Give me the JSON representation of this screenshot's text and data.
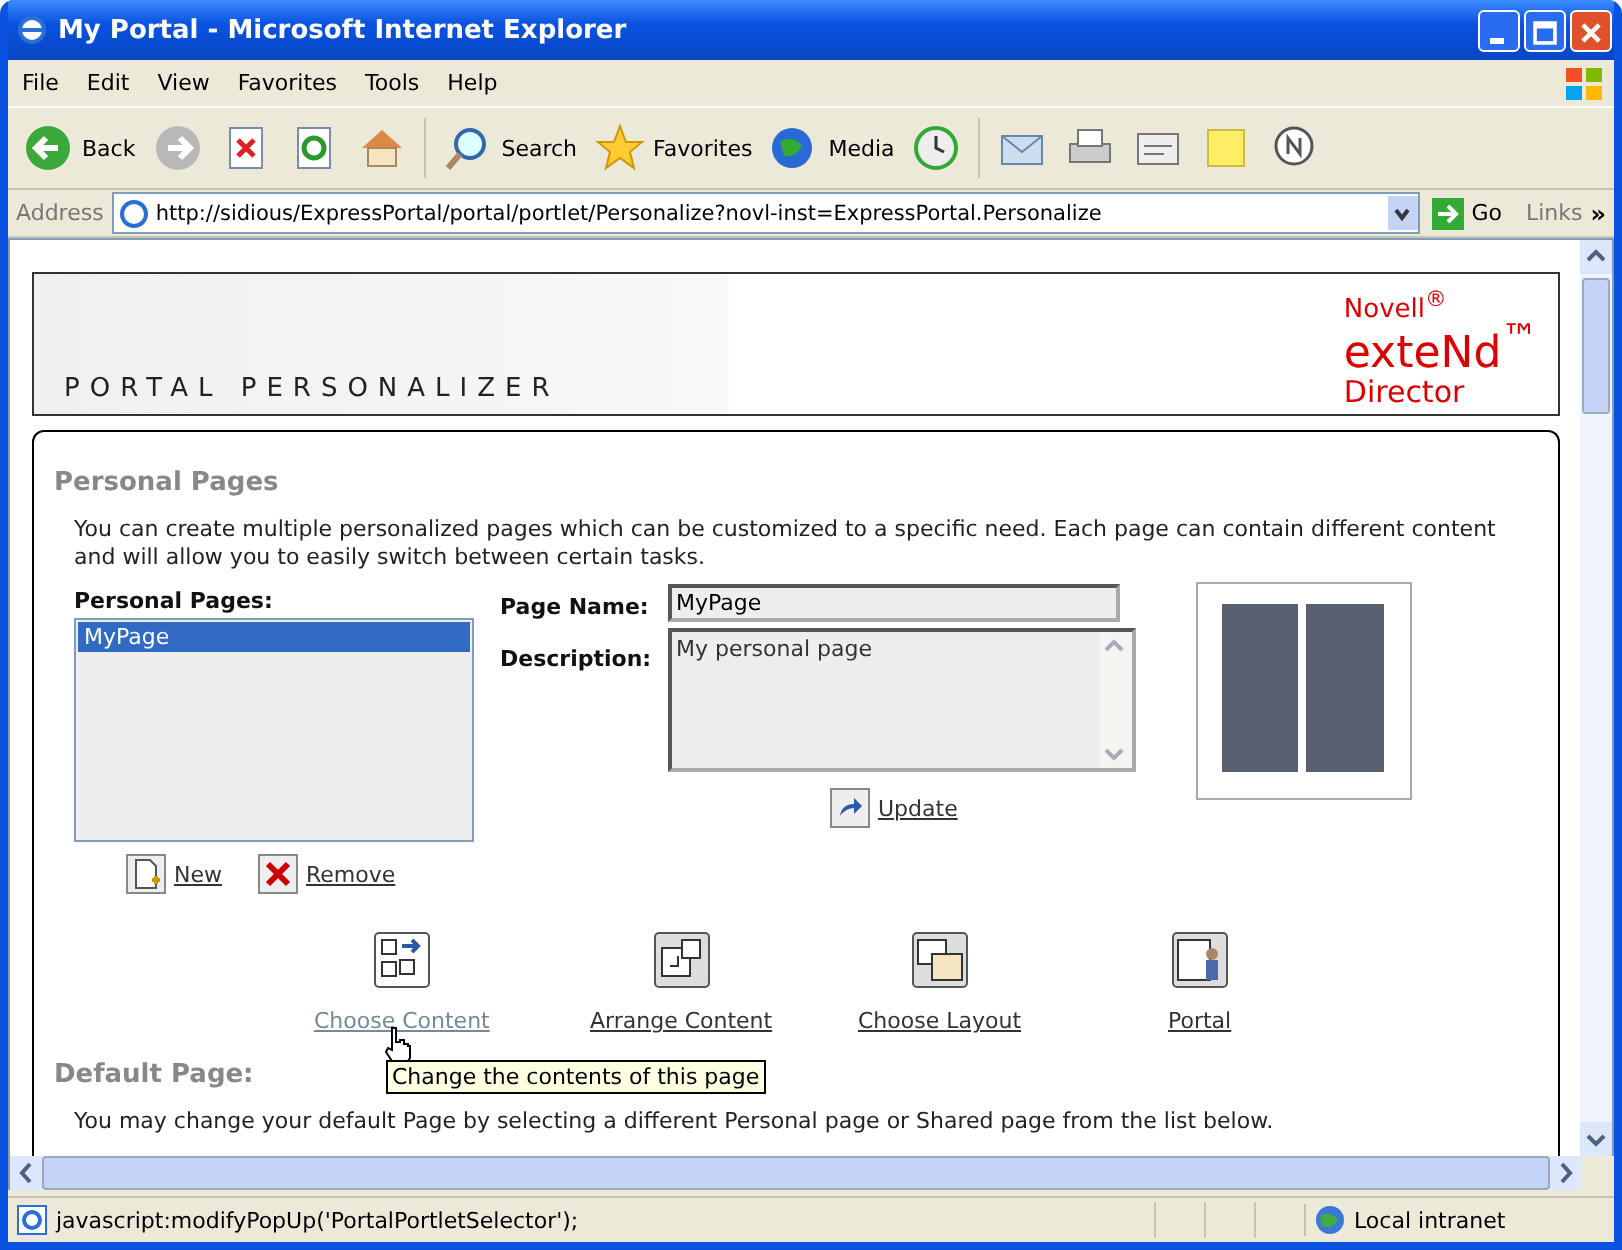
{
  "window": {
    "title": "My Portal - Microsoft Internet Explorer"
  },
  "menu_bar": [
    "File",
    "Edit",
    "View",
    "Favorites",
    "Tools",
    "Help"
  ],
  "toolbar": [
    {
      "kind": "back",
      "label": "Back"
    },
    {
      "kind": "forward"
    },
    {
      "kind": "stop"
    },
    {
      "kind": "refresh"
    },
    {
      "kind": "home"
    },
    {
      "kind": "search",
      "label": "Search"
    },
    {
      "kind": "favorites",
      "label": "Favorites"
    },
    {
      "kind": "media",
      "label": "Media"
    },
    {
      "kind": "history"
    },
    {
      "kind": "mail"
    },
    {
      "kind": "print"
    },
    {
      "kind": "edit"
    },
    {
      "kind": "note"
    },
    {
      "kind": "messenger"
    }
  ],
  "address_bar": {
    "label": "Address",
    "url": "http://sidious/ExpressPortal/portal/portlet/Personalize?novl-inst=ExpressPortal.Personalize",
    "go": "Go",
    "links": "Links",
    "chevron": "»"
  },
  "banner": {
    "title": "PORTAL PERSONALIZER",
    "logo": [
      "Novell$^{®}$",
      "exteNd$^{™}$",
      "Director"
    ]
  },
  "personal_pages": {
    "heading": "Personal Pages",
    "intro": "You can create multiple personalized pages which can be customized to a specific need. Each page can contain different content and will allow you to easily switch between certain tasks.",
    "list_label": "Personal Pages:",
    "pages": [
      {
        "name": "MyPage",
        "selected": true
      }
    ],
    "page_name_label": "Page Name:",
    "page_name": "MyPage",
    "description_label": "Description:",
    "description": "My personal page",
    "update": "Update",
    "new": "New",
    "remove": "Remove"
  },
  "actions": [
    {
      "kind": "choose_content",
      "label": "Choose Content",
      "hovered": true
    },
    {
      "kind": "arrange",
      "label": "Arrange Content",
      "hovered": false
    },
    {
      "kind": "layout",
      "label": "Choose Layout",
      "hovered": false
    },
    {
      "kind": "portal",
      "label": "Portal",
      "hovered": false
    }
  ],
  "tooltip": "Change the contents of this page",
  "default_page": {
    "heading": "Default Page:",
    "text": "You may change your default Page by selecting a different Personal page or Shared page from the list below."
  },
  "status_bar": {
    "text": "javascript:modifyPopUp('PortalPortletSelector');",
    "zone": "Local intranet"
  }
}
